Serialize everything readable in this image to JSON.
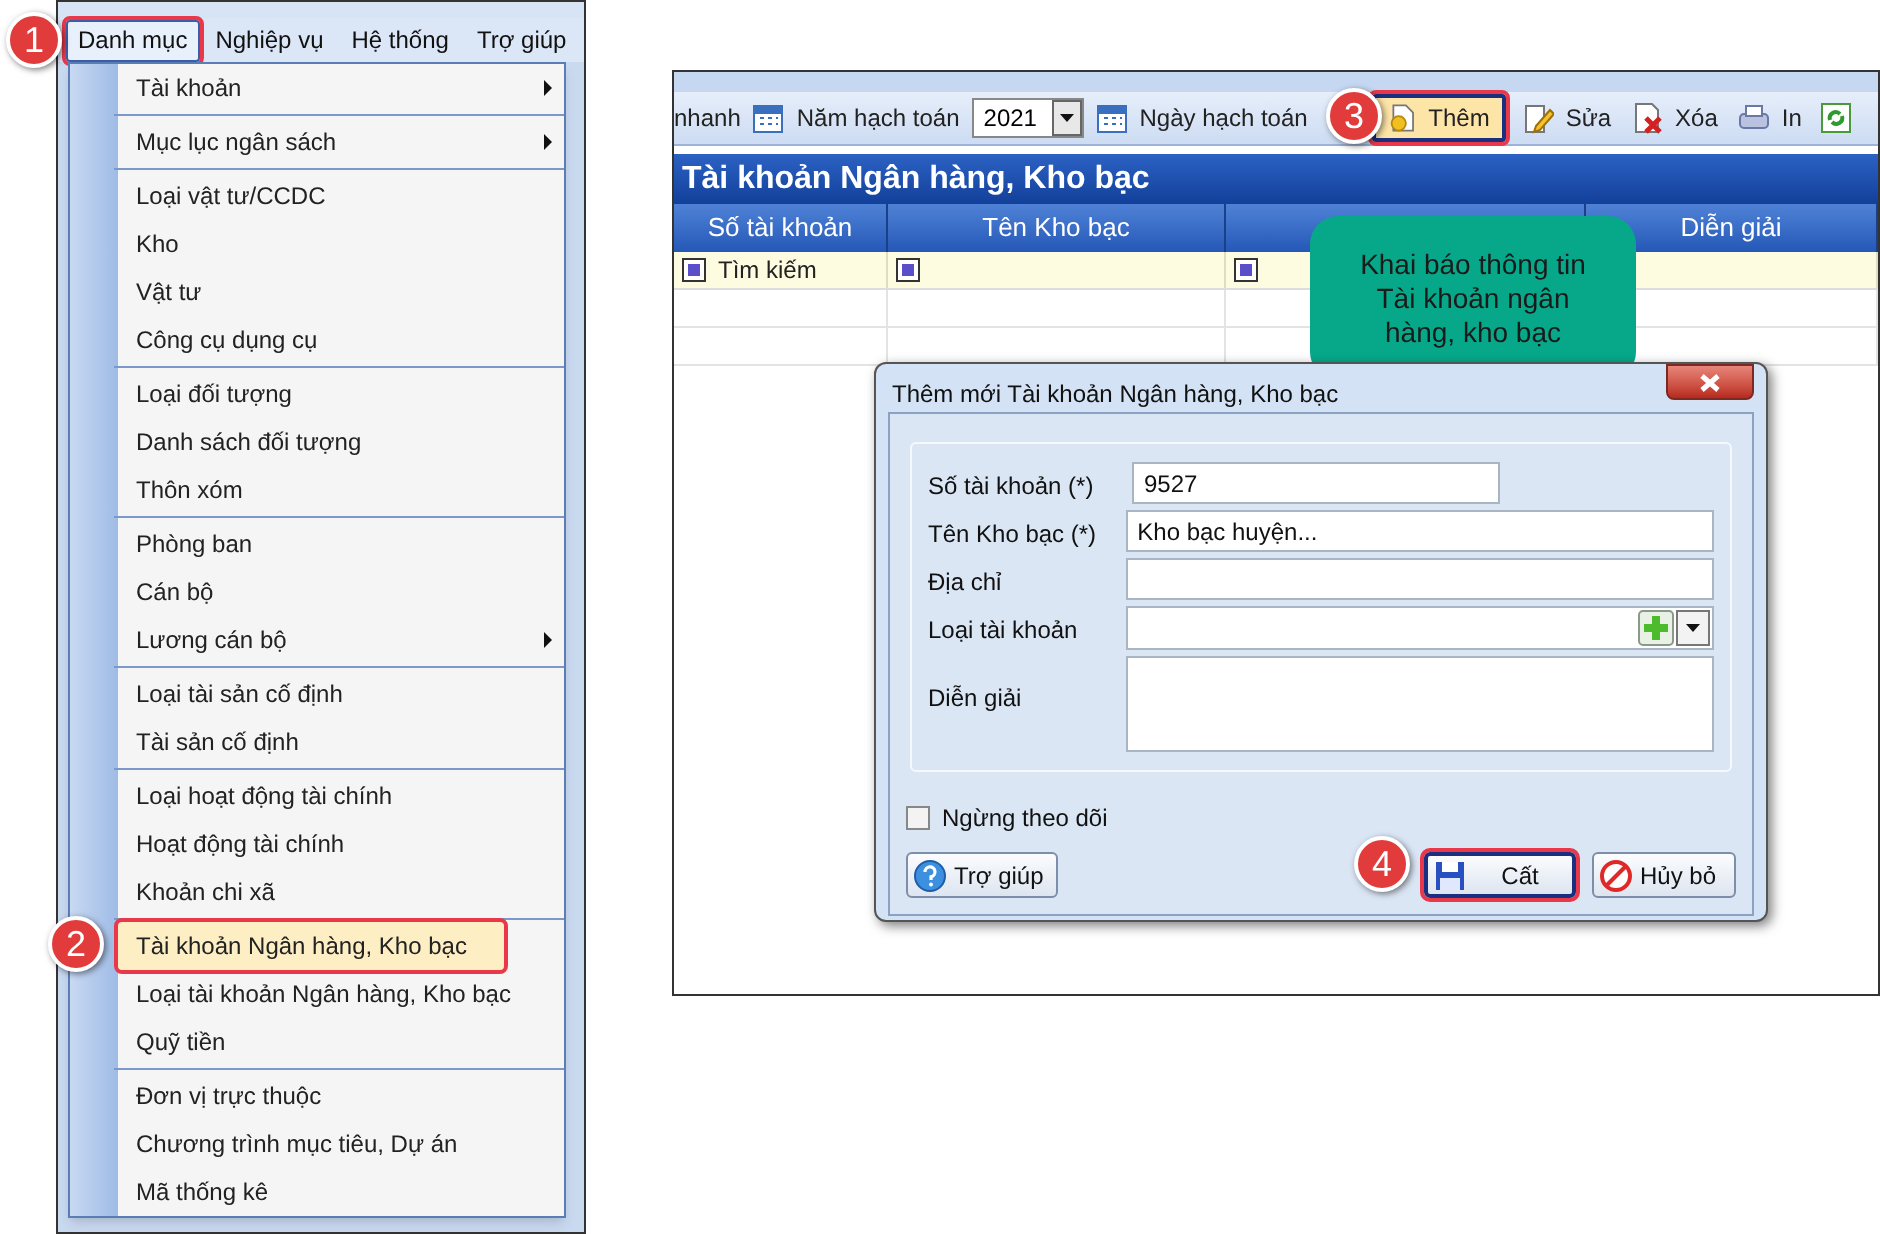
{
  "menu_screenshot": {
    "menu_bar": [
      {
        "label": "Danh mục",
        "selected": true,
        "highlighted": true
      },
      {
        "label": "Nghiệp vụ",
        "selected": false,
        "highlighted": false
      },
      {
        "label": "Hệ thống",
        "selected": false,
        "highlighted": false
      },
      {
        "label": "Trợ giúp",
        "selected": false,
        "highlighted": false
      }
    ],
    "dropdown_groups": [
      [
        {
          "label": "Tài khoản",
          "has_submenu": true,
          "selected": false,
          "highlighted": false
        }
      ],
      [
        {
          "label": "Mục lục ngân sách",
          "has_submenu": true,
          "selected": false,
          "highlighted": false
        }
      ],
      [
        {
          "label": "Loại vật tư/CCDC",
          "has_submenu": false,
          "selected": false,
          "highlighted": false
        },
        {
          "label": "Kho",
          "has_submenu": false,
          "selected": false,
          "highlighted": false
        },
        {
          "label": "Vật tư",
          "has_submenu": false,
          "selected": false,
          "highlighted": false
        },
        {
          "label": "Công cụ dụng cụ",
          "has_submenu": false,
          "selected": false,
          "highlighted": false
        }
      ],
      [
        {
          "label": "Loại đối tượng",
          "has_submenu": false,
          "selected": false,
          "highlighted": false
        },
        {
          "label": "Danh sách đối tượng",
          "has_submenu": false,
          "selected": false,
          "highlighted": false
        },
        {
          "label": "Thôn xóm",
          "has_submenu": false,
          "selected": false,
          "highlighted": false
        }
      ],
      [
        {
          "label": "Phòng ban",
          "has_submenu": false,
          "selected": false,
          "highlighted": false
        },
        {
          "label": "Cán bộ",
          "has_submenu": false,
          "selected": false,
          "highlighted": false
        },
        {
          "label": "Lương cán bộ",
          "has_submenu": true,
          "selected": false,
          "highlighted": false
        }
      ],
      [
        {
          "label": "Loại tài sản cố định",
          "has_submenu": false,
          "selected": false,
          "highlighted": false
        },
        {
          "label": "Tài sản cố định",
          "has_submenu": false,
          "selected": false,
          "highlighted": false
        }
      ],
      [
        {
          "label": "Loại hoạt động tài chính",
          "has_submenu": false,
          "selected": false,
          "highlighted": false
        },
        {
          "label": "Hoạt động tài chính",
          "has_submenu": false,
          "selected": false,
          "highlighted": false
        },
        {
          "label": "Khoản chi xã",
          "has_submenu": false,
          "selected": false,
          "highlighted": false
        }
      ],
      [
        {
          "label": "Tài khoản Ngân hàng, Kho bạc",
          "has_submenu": false,
          "selected": true,
          "highlighted": true
        },
        {
          "label": "Loại tài khoản Ngân hàng, Kho bạc",
          "has_submenu": false,
          "selected": false,
          "highlighted": false
        },
        {
          "label": "Quỹ tiền",
          "has_submenu": false,
          "selected": false,
          "highlighted": false
        }
      ],
      [
        {
          "label": "Đơn vị trực thuộc",
          "has_submenu": false,
          "selected": false,
          "highlighted": false
        },
        {
          "label": "Chương trình mục tiêu, Dự án",
          "has_submenu": false,
          "selected": false,
          "highlighted": false
        },
        {
          "label": "Mã thống kê",
          "has_submenu": false,
          "selected": false,
          "highlighted": false
        }
      ]
    ]
  },
  "app_screenshot": {
    "toolbar": [
      {
        "kind": "text",
        "label": "nhanh"
      },
      {
        "kind": "calendar",
        "label": "Năm hạch toán"
      },
      {
        "kind": "select",
        "value": "2021"
      },
      {
        "kind": "calendar",
        "label": "Ngày hạch toán"
      },
      {
        "kind": "add",
        "label": "Thêm",
        "highlighted": true
      },
      {
        "kind": "edit",
        "label": "Sửa",
        "highlighted": false
      },
      {
        "kind": "delete",
        "label": "Xóa",
        "highlighted": false
      },
      {
        "kind": "print",
        "label": "In",
        "highlighted": false
      },
      {
        "kind": "refresh"
      }
    ],
    "title": "Tài khoản Ngân hàng, Kho bạc",
    "columns": [
      {
        "label": "Số tài khoản"
      },
      {
        "label": "Tên Kho bạc"
      },
      {},
      {
        "label": "Diễn giải"
      }
    ],
    "filter_text": "Tìm kiếm",
    "callout": "Khai báo thông tin Tài khoản ngân hàng, kho bạc",
    "dialog": {
      "title": "Thêm mới Tài khoản Ngân hàng, Kho bạc",
      "fields": [
        {
          "kind": "short",
          "label": "Số tài khoản (*)",
          "value": "9527"
        },
        {
          "kind": "text",
          "label": "Tên Kho bạc (*)",
          "value": "Kho bạc huyện..."
        },
        {
          "kind": "text",
          "label": "Địa chỉ"
        },
        {
          "kind": "combo",
          "label": "Loại tài khoản"
        },
        {
          "kind": "memo",
          "label": "Diễn giải"
        }
      ],
      "checkbox": {
        "label": "Ngừng theo dõi",
        "checked": false
      },
      "buttons": [
        {
          "kind": "help",
          "label": "Trợ giúp",
          "highlighted": false
        },
        {
          "kind": "save",
          "label": "Cất",
          "highlighted": true
        },
        {
          "kind": "cancel",
          "label": "Hủy bỏ",
          "highlighted": false
        }
      ]
    }
  },
  "step_badges": [
    "1",
    "2",
    "3",
    "4"
  ]
}
